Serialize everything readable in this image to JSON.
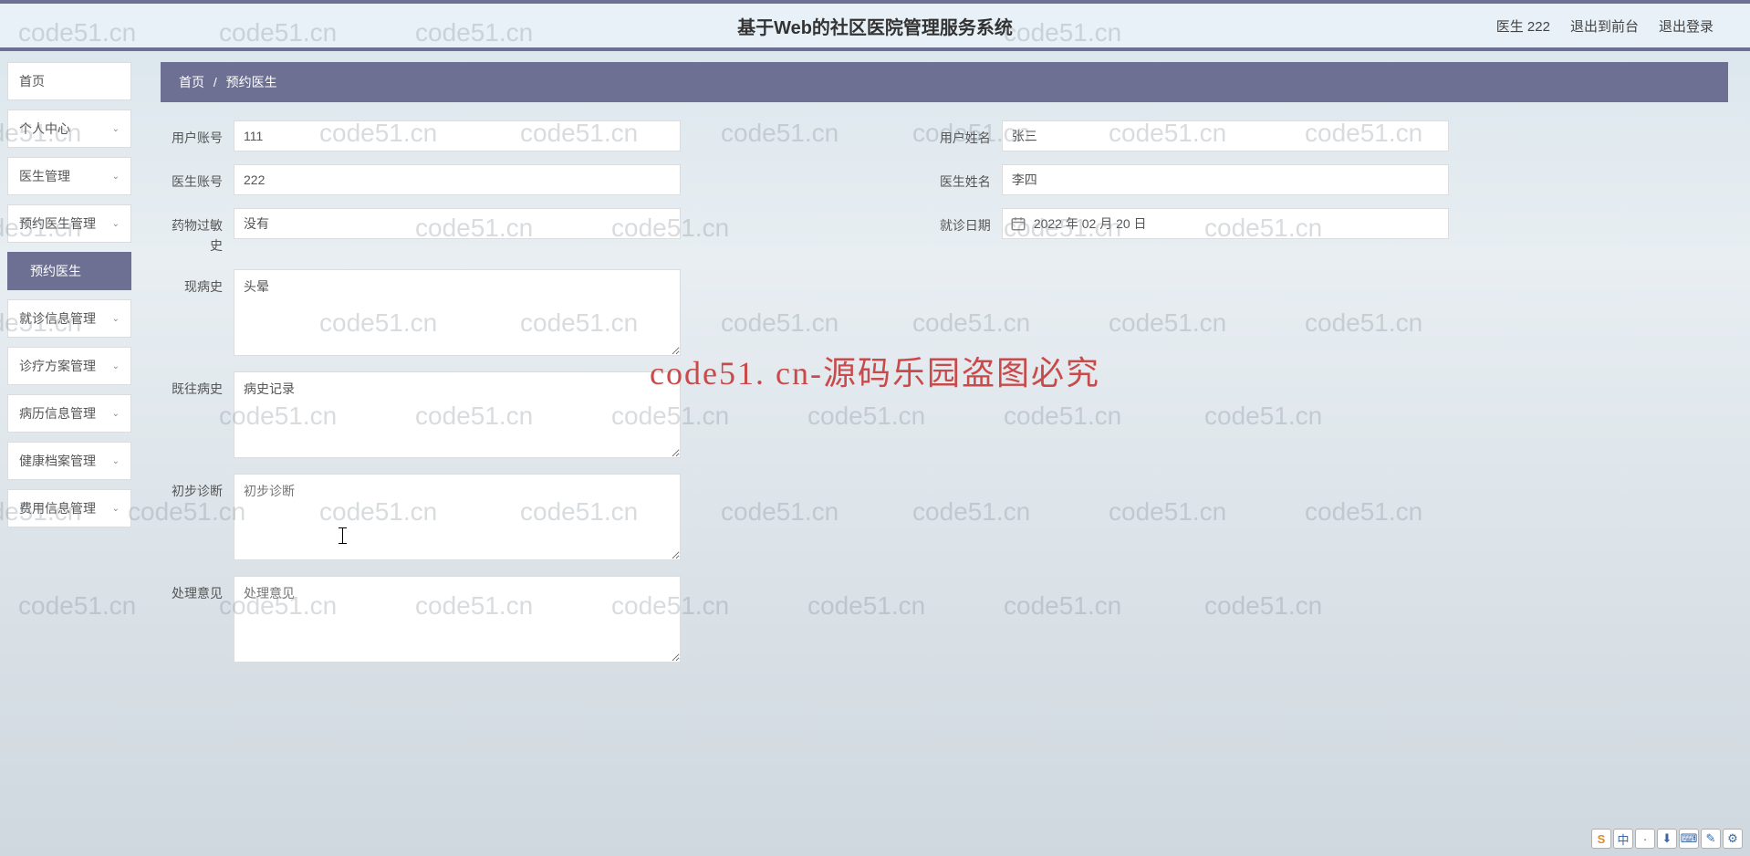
{
  "header": {
    "title": "基于Web的社区医院管理服务系统",
    "user_label": "医生 222",
    "exit_front": "退出到前台",
    "logout": "退出登录"
  },
  "sidebar": {
    "items": [
      {
        "label": "首页",
        "expandable": false
      },
      {
        "label": "个人中心",
        "expandable": true
      },
      {
        "label": "医生管理",
        "expandable": true
      },
      {
        "label": "预约医生管理",
        "expandable": true
      },
      {
        "label": "预约医生",
        "expandable": false,
        "active": true
      },
      {
        "label": "就诊信息管理",
        "expandable": true
      },
      {
        "label": "诊疗方案管理",
        "expandable": true
      },
      {
        "label": "病历信息管理",
        "expandable": true
      },
      {
        "label": "健康档案管理",
        "expandable": true
      },
      {
        "label": "费用信息管理",
        "expandable": true
      }
    ]
  },
  "breadcrumb": {
    "home": "首页",
    "current": "预约医生"
  },
  "form": {
    "user_account": {
      "label": "用户账号",
      "value": "111"
    },
    "user_name": {
      "label": "用户姓名",
      "value": "张三"
    },
    "doctor_account": {
      "label": "医生账号",
      "value": "222"
    },
    "doctor_name": {
      "label": "医生姓名",
      "value": "李四"
    },
    "drug_allergy": {
      "label": "药物过敏史",
      "value": "没有"
    },
    "visit_date": {
      "label": "就诊日期",
      "value": "2022 年 02 月 20 日"
    },
    "present_history": {
      "label": "现病史",
      "value": "头晕"
    },
    "past_history": {
      "label": "既往病史",
      "value": "病史记录"
    },
    "preliminary_diagnosis": {
      "label": "初步诊断",
      "value": "",
      "placeholder": "初步诊断"
    },
    "treatment_opinion": {
      "label": "处理意见",
      "value": "",
      "placeholder": "处理意见"
    }
  },
  "watermark": "code51.cn",
  "watermark_big": "code51. cn-源码乐园盗图必究",
  "ime": [
    "S",
    "中",
    "ㆍ",
    "⬇",
    "⌨",
    "✎",
    "⚙"
  ]
}
